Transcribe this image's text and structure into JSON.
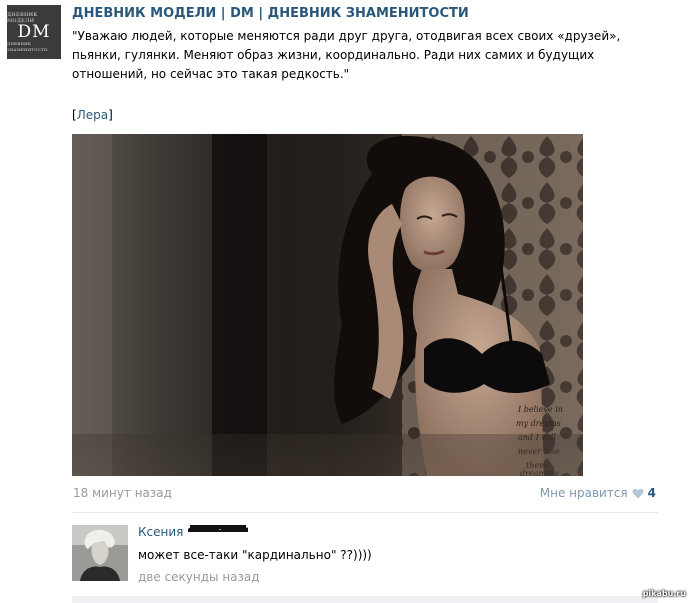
{
  "post": {
    "group_avatar": {
      "line1": "ДНЕВНИК МОДЕЛИ",
      "monogram": "DM",
      "line2": "ДНЕВНИК ЗНАМЕНИТОСТИ"
    },
    "group_name": "ДНЕВНИК МОДЕЛИ | DM | ДНЕВНИК ЗНАМЕНИТОСТИ",
    "text": "\"Уважаю людей, которые меняются ради друг друга, отодвигая всех своих «друзей», пьянки, гулянки. Меняют образ жизни, координально. Ради них самих и будущих отношений, но сейчас это такая редкость.\"",
    "signature_open": "[",
    "signature_name": "Лера",
    "signature_close": "]",
    "tattoo_text": [
      "I believe in",
      "my dreams",
      "and I will",
      "never lose",
      "them",
      "dreaming"
    ],
    "time": "18 минут назад",
    "like_label": "Мне нравится",
    "like_count": "4"
  },
  "comment": {
    "author": "Ксения",
    "text": "может все-таки \"кардинально\" ??))))",
    "time": "две секунды назад"
  },
  "watermark": "pikabu.ru",
  "colors": {
    "link": "#2b587a",
    "muted": "#999999",
    "like": "#7c97b4"
  }
}
